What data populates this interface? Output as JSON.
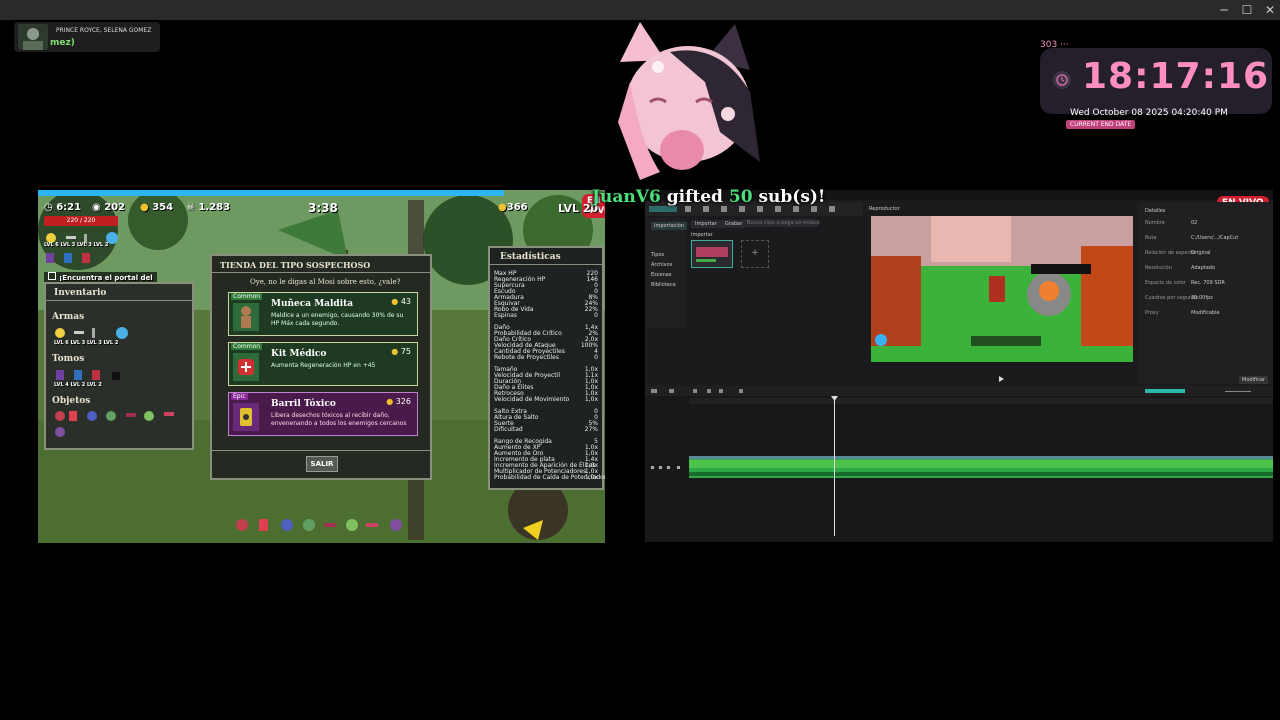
{
  "window": {
    "minimize": "─",
    "maximize": "☐",
    "close": "✕"
  },
  "chat": {
    "name": "PRINCE ROYCE, SELENA GOMEZ",
    "message": "mez)"
  },
  "alert": {
    "user": "JuanV6",
    "middle": "gifted",
    "count": "50",
    "tail": "sub(s)!"
  },
  "clock": {
    "count": "303",
    "dots": "···",
    "time": "18:17:16",
    "date": "Wed October 08 2025 04:20:40 PM",
    "label": "CURRENT END DATE"
  },
  "game": {
    "badge": "EN VIVO",
    "hud": {
      "time": "6:21",
      "shield": "202",
      "gold": "354",
      "kills": "1.283",
      "timer": "3:38",
      "coins": "366",
      "level": "LVL 20",
      "hp": "220 / 220"
    },
    "quest": "¡Encuentra el portal del",
    "inventory": {
      "title": "Inventario",
      "armas": "Armas",
      "armas_levels": "LVL 6  LVL 3  LVL 3  LVL 2",
      "tomos": "Tomos",
      "tomos_levels": "LVL 4  LVL 2  LVL 2",
      "objetos": "Objetos"
    },
    "shop": {
      "title": "TIENDA DEL TIPO SOSPECHOSO",
      "subtitle": "Oye, no le digas al Mosi sobre esto, ¿vale?",
      "items": [
        {
          "rarity": "Common",
          "name": "Muñeca Maldita",
          "price": "43",
          "desc": "Maldice a un enemigo, causando 30% de su HP Máx cada segundo."
        },
        {
          "rarity": "Common",
          "name": "Kit Médico",
          "price": "75",
          "desc": "Aumenta Regeneración HP en +45"
        },
        {
          "rarity": "Epic",
          "name": "Barril Tóxico",
          "price": "326",
          "desc": "Libera desechos tóxicos al recibir daño, envenenando a todos los enemigos cercanos"
        }
      ],
      "exit": "SALIR"
    },
    "stats": {
      "title": "Estadísticas",
      "rows": [
        [
          "Max HP",
          "220"
        ],
        [
          "Regeneración HP",
          "146"
        ],
        [
          "Supercura",
          "0"
        ],
        [
          "Escudo",
          "0"
        ],
        [
          "Armadura",
          "8%"
        ],
        [
          "Esquivar",
          "24%"
        ],
        [
          "Robo de Vida",
          "22%"
        ],
        [
          "Espinas",
          "0"
        ],
        [
          "",
          ""
        ],
        [
          "Daño",
          "1,4x"
        ],
        [
          "Probabilidad de Crítico",
          "2%"
        ],
        [
          "Daño Crítico",
          "2,0x"
        ],
        [
          "Velocidad de Ataque",
          "100%"
        ],
        [
          "Cantidad de Proyectiles",
          "4"
        ],
        [
          "Rebote de Proyectiles",
          "0"
        ],
        [
          "",
          ""
        ],
        [
          "Tamaño",
          "1,0x"
        ],
        [
          "Velocidad de Proyectil",
          "1,1x"
        ],
        [
          "Duración",
          "1,0x"
        ],
        [
          "Daño a Élites",
          "1,0x"
        ],
        [
          "Retroceso",
          "1,0x"
        ],
        [
          "Velocidad de Movimiento",
          "1,0x"
        ],
        [
          "",
          ""
        ],
        [
          "Salto Extra",
          "0"
        ],
        [
          "Altura de Salto",
          "0"
        ],
        [
          "Suerte",
          "5%"
        ],
        [
          "Dificultad",
          "27%"
        ],
        [
          "",
          ""
        ],
        [
          "Rango de Recogida",
          "5"
        ],
        [
          "Aumento de XP",
          "1,0x"
        ],
        [
          "Aumento de Oro",
          "1,0x"
        ],
        [
          "Incremento de plata",
          "1,4x"
        ],
        [
          "Incremento de Aparición de Élites",
          "1,0x"
        ],
        [
          "Multiplicador de Potenciadores",
          "1,0x"
        ],
        [
          "Probabilidad de Caída de Potenciador",
          "1,0x"
        ]
      ]
    }
  },
  "editor": {
    "badge": "EN VIVO",
    "menu": [
      "Importar",
      "Grabar"
    ],
    "search_placeholder": "Busca clips o pega un enlace",
    "media_label": "Importar",
    "sidebar": [
      "Importación",
      "Tipos",
      "Archivos",
      "Escenas",
      "Biblioteca"
    ],
    "player_title": "Reproductor",
    "props_title": "Detalles",
    "props": [
      [
        "Nombre",
        "02"
      ],
      [
        "Ruta",
        "C:/Users/.../CapCut"
      ],
      [
        "Relación de aspecto",
        "Original"
      ],
      [
        "Resolución",
        "Adaptado"
      ],
      [
        "Espacio de color",
        "Rec. 709 SDR"
      ],
      [
        "Cuadros por segundo",
        "30.00fps"
      ],
      [
        "Proxy",
        "Modificable"
      ]
    ],
    "modify": "Modificar"
  },
  "colors": {
    "accent_pink": "#ff8ec0",
    "live_red": "#d02030",
    "game_blue": "#2ab6f0",
    "timeline_green": "#2fa84a"
  }
}
